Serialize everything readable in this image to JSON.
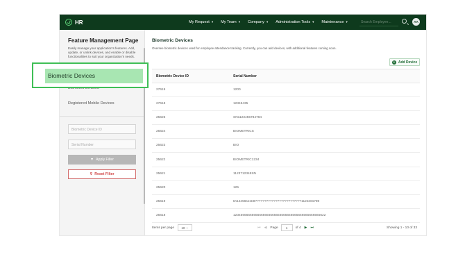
{
  "app": {
    "logo_text": "HR"
  },
  "nav": {
    "items": [
      "My Request",
      "My Team",
      "Company",
      "Administration Tools",
      "Maintenance"
    ],
    "caret": "▾",
    "search_placeholder": "Search Employee...",
    "user_initials": "AA"
  },
  "sidebar": {
    "title": "Feature Management Page",
    "description": "Easily manage your application's features. Add, update, or unlink devices, and enable or disable functionalities to suit your organization's needs.",
    "menu": [
      "Biometric Devices",
      "Registered Mobile Devices"
    ],
    "filters": {
      "device_id_placeholder": "Biometric Device ID",
      "serial_placeholder": "Serial Number"
    },
    "apply_label": "Apply Filter",
    "reset_label": "Reset Filter"
  },
  "main": {
    "title": "Biometric Devices",
    "description": "Oversee biometric devices used for employee attendance tracking. Currently, you can add devices, with additional features coming soon.",
    "add_label": "Add Device",
    "columns": [
      "Biometric Device ID",
      "Serial Number"
    ],
    "rows": [
      [
        "27619",
        "1200"
      ],
      [
        "27618",
        "12345435"
      ],
      [
        "25626",
        "SN1123455784784"
      ],
      [
        "25624",
        "BIOMETRICS"
      ],
      [
        "25623",
        "BIO"
      ],
      [
        "25622",
        "BIOMETRIC1234"
      ],
      [
        "25621",
        "1123712345SN"
      ],
      [
        "25620",
        "125"
      ],
      [
        "25619",
        "kh12456seeb8?????????????????????????112346s789"
      ],
      [
        "25618",
        "12345656565656565656565656565656565656565656565622"
      ]
    ],
    "pager": {
      "items_per_page_label": "Items per page",
      "items_per_page": "10",
      "page_label": "Page",
      "page": "1",
      "of_label": "of 4",
      "showing": "Showing 1 - 10 of 33"
    }
  },
  "highlight": {
    "label": "Biometric Devices"
  },
  "colors": {
    "topbar": "#0e3a1d",
    "accent": "#1d6b34",
    "highlight_border": "#3fbf56",
    "highlight_fill": "#a8e6b2",
    "reset": "#d04545"
  }
}
